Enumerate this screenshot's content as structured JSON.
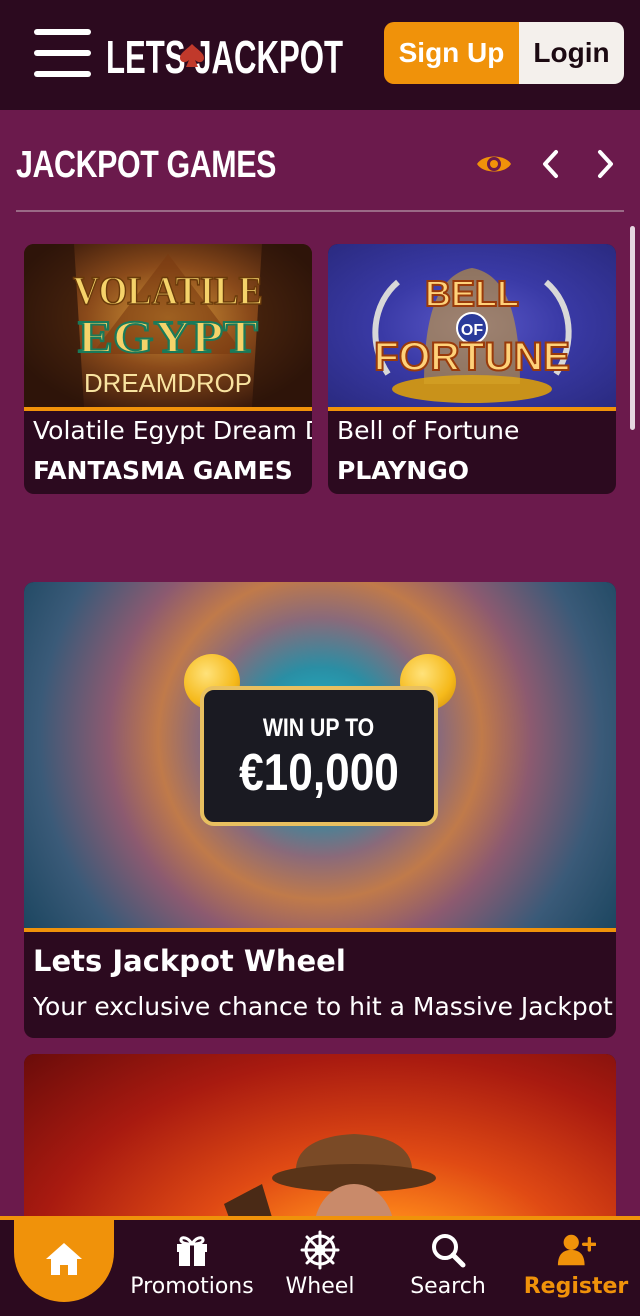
{
  "header": {
    "logo_text": "LETS JACKPOT",
    "signup_label": "Sign Up",
    "login_label": "Login"
  },
  "section": {
    "title": "JACKPOT GAMES",
    "games": [
      {
        "name": "Volatile Egypt Dream Drop",
        "provider": "FANTASMA GAMES",
        "art_text": [
          "VOLATILE",
          "EGYPT",
          "DREAMDROP"
        ]
      },
      {
        "name": "Bell of Fortune",
        "provider": "PLAYNGO",
        "art_text": [
          "BELL",
          "OF",
          "FORTUNE"
        ]
      }
    ]
  },
  "promos": [
    {
      "title": "Lets Jackpot Wheel",
      "description": "Your exclusive chance to hit a Massive Jackpot!",
      "art_small": "WIN UP TO",
      "art_big": "€10,000"
    }
  ],
  "bottom_nav": {
    "items": [
      {
        "label": "Promotions",
        "icon": "gift-icon"
      },
      {
        "label": "Wheel",
        "icon": "wheel-icon"
      },
      {
        "label": "Search",
        "icon": "search-icon"
      },
      {
        "label": "Register",
        "icon": "add-user-icon"
      }
    ]
  },
  "colors": {
    "accent": "#f0920a",
    "background": "#6b1a4c",
    "header": "#2c0a1f",
    "card": "#2c0a1f"
  }
}
